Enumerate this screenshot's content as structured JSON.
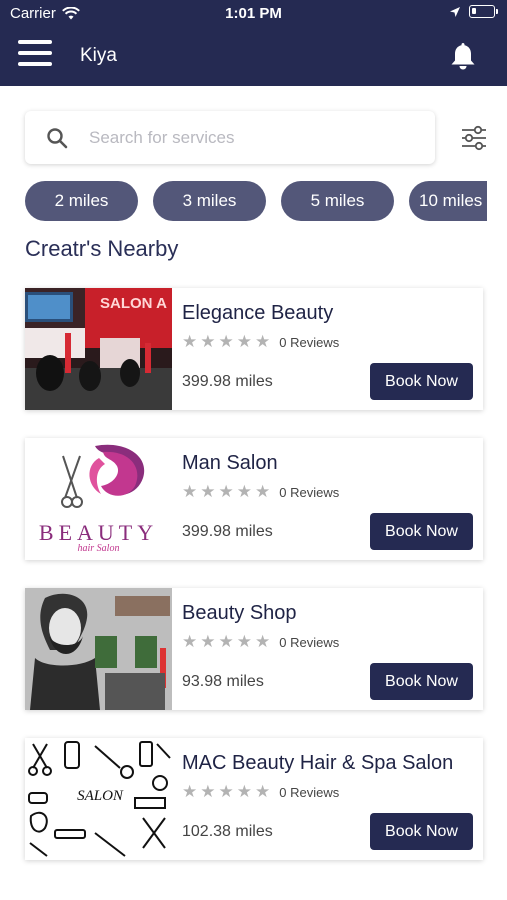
{
  "status_bar": {
    "carrier": "Carrier",
    "time": "1:01 PM"
  },
  "app_bar": {
    "title": "Kiya",
    "menu_icon": "hamburger-menu-icon",
    "notification_icon": "bell-icon"
  },
  "search": {
    "placeholder": "Search for services",
    "value": ""
  },
  "distance_filters": [
    "2 miles",
    "3 miles",
    "5 miles",
    "10 miles"
  ],
  "section_title": "Creatr's Nearby",
  "providers": [
    {
      "name": "Elegance Beauty",
      "reviews": "0 Reviews",
      "rating": 0,
      "distance": "399.98 miles",
      "cta": "Book Now"
    },
    {
      "name": "Man Salon",
      "reviews": "0 Reviews",
      "rating": 0,
      "distance": "399.98 miles",
      "cta": "Book Now",
      "logo_text": "BEAUTY",
      "logo_subtext": "hair Salon"
    },
    {
      "name": "Beauty Shop",
      "reviews": "0 Reviews",
      "rating": 0,
      "distance": "93.98 miles",
      "cta": "Book Now"
    },
    {
      "name": "MAC Beauty Hair & Spa Salon",
      "reviews": "0 Reviews",
      "rating": 0,
      "distance": "102.38 miles",
      "cta": "Book Now",
      "logo_text": "SALON"
    }
  ],
  "colors": {
    "primary": "#252a52",
    "chip": "#535779",
    "star_empty": "#b3b3b3"
  }
}
